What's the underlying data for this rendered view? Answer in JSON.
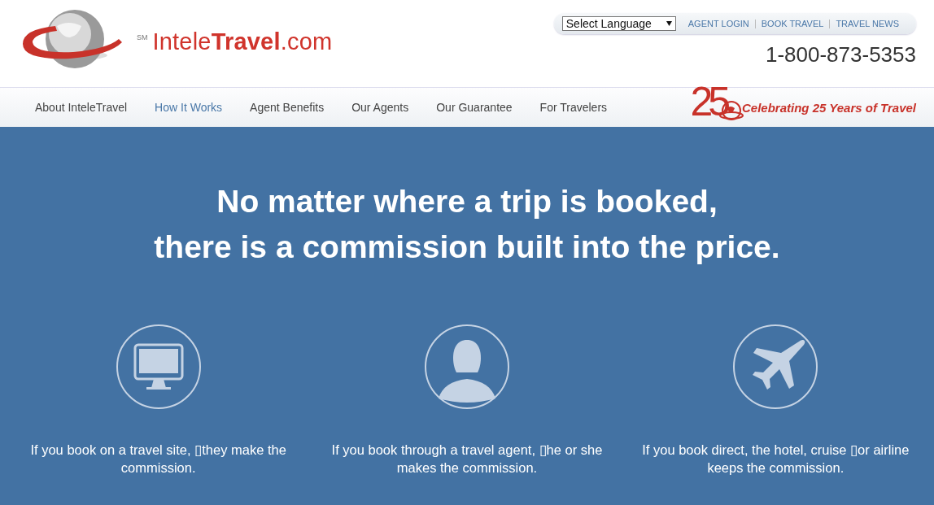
{
  "header": {
    "logo": {
      "name": "Intele**Travel**.com",
      "mark": "SM"
    },
    "language_select": {
      "value": "Select Language"
    },
    "top_links": [
      "AGENT LOGIN",
      "BOOK TRAVEL",
      "TRAVEL NEWS"
    ],
    "phone": "1-800-873-5353"
  },
  "nav": {
    "items": [
      {
        "label": "About InteleTravel",
        "selected": false
      },
      {
        "label": "How It Works",
        "selected": true
      },
      {
        "label": "Agent Benefits",
        "selected": false
      },
      {
        "label": "Our Agents",
        "selected": false
      },
      {
        "label": "Our Guarantee",
        "selected": false
      },
      {
        "label": "For Travelers",
        "selected": false
      }
    ],
    "anniversary": {
      "number": "25",
      "text": "Celebrating 25 Years of Travel"
    }
  },
  "hero": {
    "headline": [
      "No matter where a trip is booked,",
      "there is a commission built into the price."
    ],
    "features": [
      {
        "kind": "computer",
        "text": "If you book on a travel site, ▯they make the commission."
      },
      {
        "kind": "person",
        "text": "If you book through a travel agent, ▯he or she makes the commission."
      },
      {
        "kind": "airplane",
        "text": "If you book direct, the hotel, cruise ▯or airline keeps the commission."
      }
    ]
  }
}
